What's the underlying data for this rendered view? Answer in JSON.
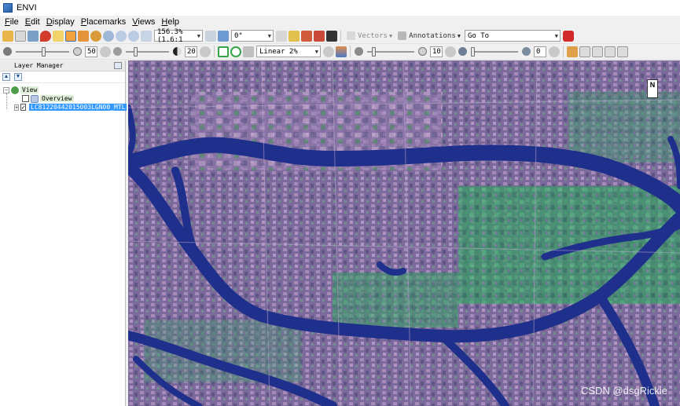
{
  "window": {
    "title": "ENVI"
  },
  "menubar": [
    {
      "underline": "F",
      "rest": "ile"
    },
    {
      "underline": "E",
      "rest": "dit"
    },
    {
      "underline": "D",
      "rest": "isplay"
    },
    {
      "underline": "P",
      "rest": "lacemarks"
    },
    {
      "underline": "V",
      "rest": "iews"
    },
    {
      "underline": "H",
      "rest": "elp"
    }
  ],
  "toolbar1": {
    "zoom_value": "156.3% (1.6:1",
    "rotation_value": "0°",
    "vectors_label": "Vectors",
    "annotations_label": "Annotations",
    "goto_value": "Go To"
  },
  "toolbar2": {
    "brightness_value": "50",
    "contrast_value": "20",
    "stretch_value": "Linear 2%",
    "sharpen_value": "10",
    "transparency_value": "0"
  },
  "layer_manager": {
    "title": "Layer Manager",
    "tree": {
      "root_label": "View",
      "overview_label": "Overview",
      "layer_label": "LC81220442015003LGN00_MTL",
      "layer_checked": "✓"
    }
  },
  "map": {
    "north_label": "N",
    "watermark": "CSDN @dsgRickie"
  },
  "colors": {
    "water": "#1e2f8c",
    "urban": "#8e72a8",
    "vegetation": "#3fae6f",
    "selection": "#3399ff"
  }
}
